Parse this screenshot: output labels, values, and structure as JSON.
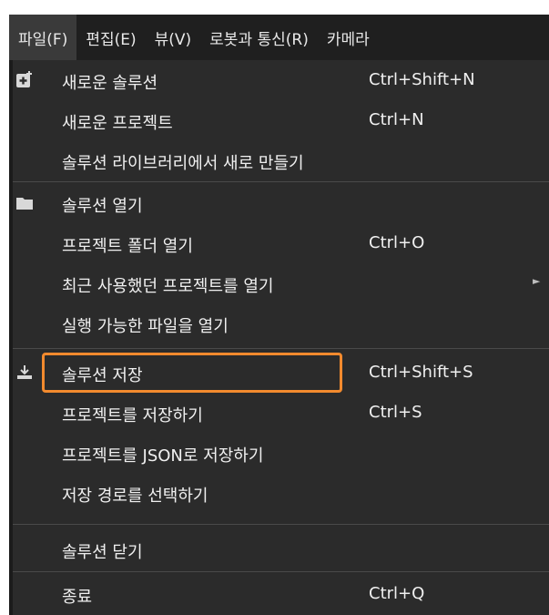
{
  "menubar": {
    "items": [
      {
        "label": "파일(F)"
      },
      {
        "label": "편집(E)"
      },
      {
        "label": "뷰(V)"
      },
      {
        "label": "로봇과 통신(R)"
      },
      {
        "label": "카메라"
      }
    ]
  },
  "file_menu": {
    "items": [
      {
        "label": "새로운 솔루션",
        "shortcut": "Ctrl+Shift+N",
        "icon": "new-solution-icon"
      },
      {
        "label": "새로운 프로젝트",
        "shortcut": "Ctrl+N"
      },
      {
        "label": "솔루션 라이브러리에서 새로 만들기",
        "shortcut": ""
      },
      {
        "label": "솔루션 열기",
        "shortcut": "",
        "icon": "folder-icon"
      },
      {
        "label": "프로젝트 폴더 열기",
        "shortcut": "Ctrl+O"
      },
      {
        "label": "최근 사용했던 프로젝트를 열기",
        "shortcut": "",
        "submenu": true
      },
      {
        "label": "실행 가능한 파일을 열기",
        "shortcut": ""
      },
      {
        "label": "솔루션 저장",
        "shortcut": "Ctrl+Shift+S",
        "icon": "save-icon"
      },
      {
        "label": "프로젝트를 저장하기",
        "shortcut": "Ctrl+S"
      },
      {
        "label": "프로젝트를 JSON로 저장하기",
        "shortcut": ""
      },
      {
        "label": "저장 경로를 선택하기",
        "shortcut": ""
      },
      {
        "label": "솔루션 닫기",
        "shortcut": ""
      },
      {
        "label": "종료",
        "shortcut": "Ctrl+Q"
      }
    ]
  },
  "colors": {
    "menu_background": "#2b2b2b",
    "menubar_background": "#1f1f1f",
    "text": "#f0f0f0",
    "highlight_border": "#f28a2e"
  }
}
